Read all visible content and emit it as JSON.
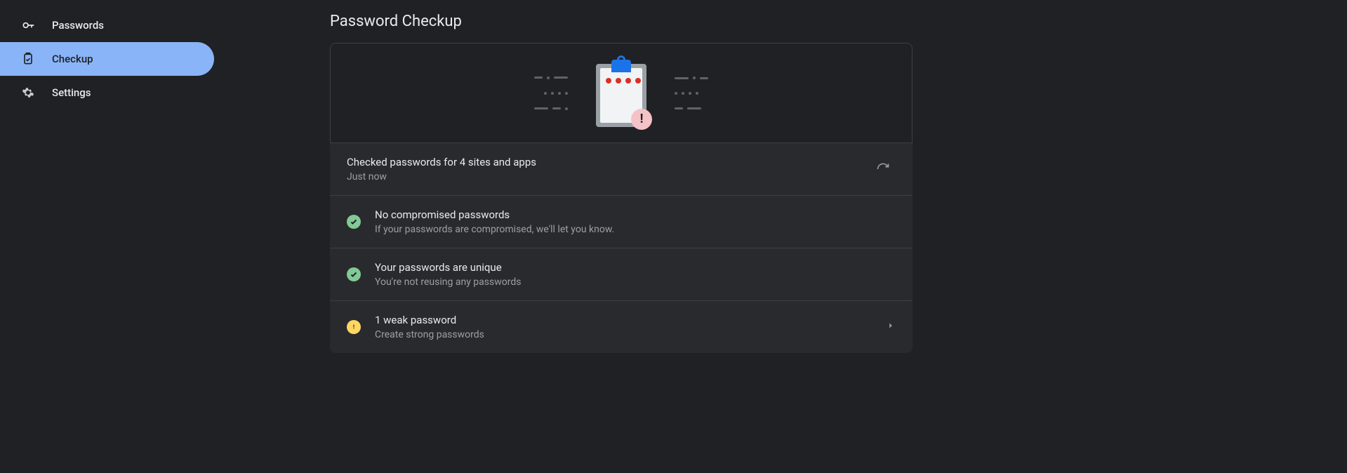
{
  "sidebar": {
    "items": [
      {
        "label": "Passwords",
        "icon": "key"
      },
      {
        "label": "Checkup",
        "icon": "clipboard-check"
      },
      {
        "label": "Settings",
        "icon": "gear"
      }
    ],
    "active_index": 1
  },
  "page": {
    "title": "Password Checkup"
  },
  "status": {
    "summary": "Checked passwords for 4 sites and apps",
    "timestamp": "Just now"
  },
  "results": [
    {
      "status": "ok",
      "title": "No compromised passwords",
      "subtitle": "If your passwords are compromised, we'll let you know.",
      "expandable": false
    },
    {
      "status": "ok",
      "title": "Your passwords are unique",
      "subtitle": "You're not reusing any passwords",
      "expandable": false
    },
    {
      "status": "warn",
      "title": "1 weak password",
      "subtitle": "Create strong passwords",
      "expandable": true
    }
  ],
  "colors": {
    "accent": "#8ab4f8",
    "ok": "#81c995",
    "warn": "#fdd663"
  }
}
